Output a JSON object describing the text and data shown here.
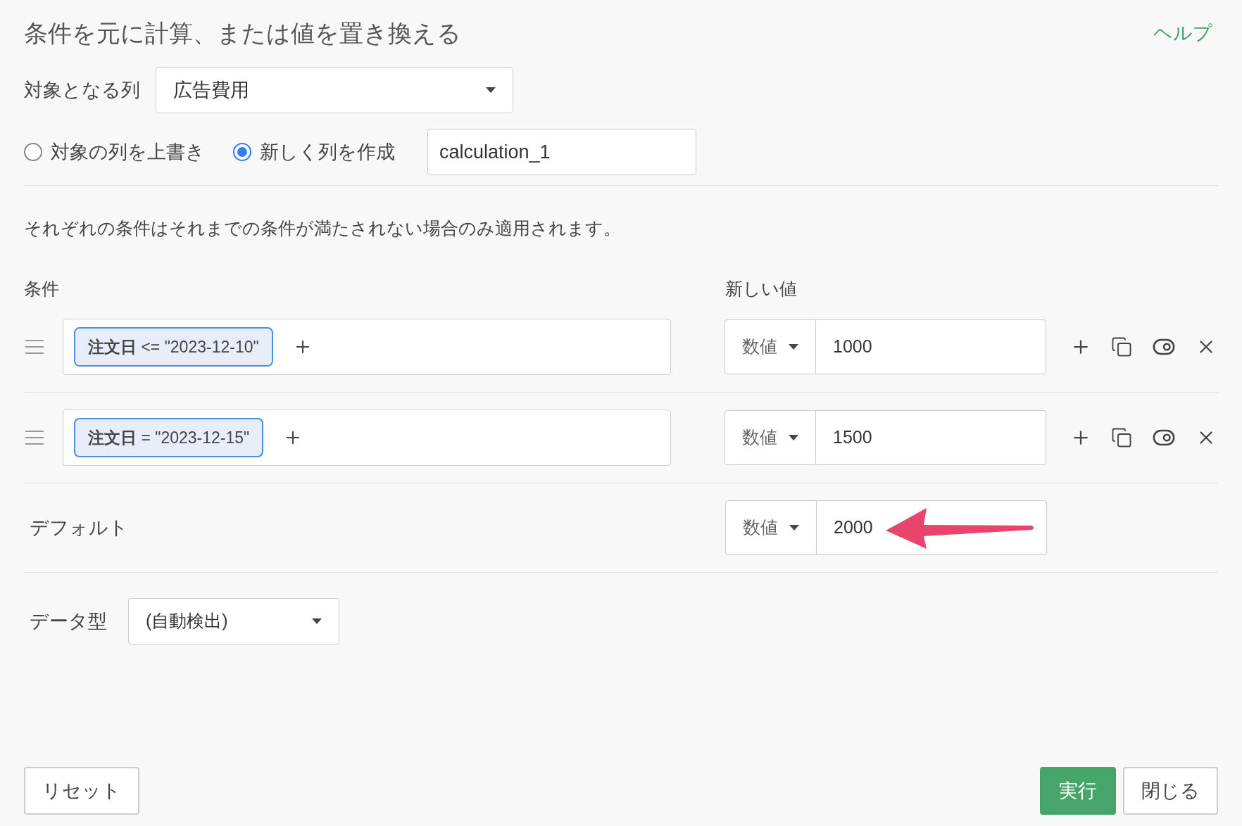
{
  "title": "条件を元に計算、または値を置き換える",
  "help_link": "ヘルプ",
  "target_column": {
    "label": "対象となる列",
    "value": "広告費用"
  },
  "output_options": [
    {
      "label": "対象の列を上書き",
      "selected": false
    },
    {
      "label": "新しく列を作成",
      "selected": true
    }
  ],
  "new_column_name": "calculation_1",
  "note": "それぞれの条件はそれまでの条件が満たされない場合のみ適用されます。",
  "headers": {
    "condition": "条件",
    "new_value": "新しい値"
  },
  "conditions": [
    {
      "chip": "**注文日** <= \"2023-12-10\"",
      "value_type": "数値",
      "value": "1000"
    },
    {
      "chip": "**注文日** = \"2023-12-15\"",
      "value_type": "数値",
      "value": "1500"
    }
  ],
  "default": {
    "label": "デフォルト",
    "value_type": "数値",
    "value": "2000"
  },
  "data_type": {
    "label": "データ型",
    "value": "(自動検出)"
  },
  "buttons": {
    "reset": "リセット",
    "run": "実行",
    "close": "閉じる"
  }
}
